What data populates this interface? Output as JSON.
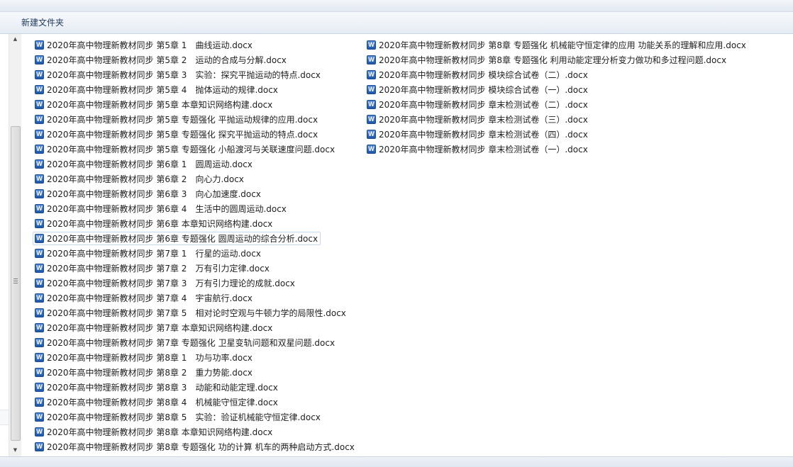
{
  "toolbar": {
    "new_folder_label": "新建文件夹"
  },
  "icons": {
    "file_icon": "word-document-icon",
    "file_icon_letter": "W",
    "file_icon_color": "#2a63b6"
  },
  "files_left": [
    "2020年高中物理新教材同步 第5章 1　曲线运动.docx",
    "2020年高中物理新教材同步 第5章 2　运动的合成与分解.docx",
    "2020年高中物理新教材同步 第5章 3　实验：探究平抛运动的特点.docx",
    "2020年高中物理新教材同步 第5章 4　抛体运动的规律.docx",
    "2020年高中物理新教材同步 第5章 本章知识网络构建.docx",
    "2020年高中物理新教材同步 第5章 专题强化 平抛运动规律的应用.docx",
    "2020年高中物理新教材同步 第5章 专题强化 探究平抛运动的特点.docx",
    "2020年高中物理新教材同步 第5章 专题强化 小船渡河与关联速度问题.docx",
    "2020年高中物理新教材同步 第6章 1　圆周运动.docx",
    "2020年高中物理新教材同步 第6章 2　向心力.docx",
    "2020年高中物理新教材同步 第6章 3　向心加速度.docx",
    "2020年高中物理新教材同步 第6章 4　生活中的圆周运动.docx",
    "2020年高中物理新教材同步 第6章 本章知识网络构建.docx",
    "2020年高中物理新教材同步 第6章 专题强化 圆周运动的综合分析.docx",
    "2020年高中物理新教材同步 第7章 1　行星的运动.docx",
    "2020年高中物理新教材同步 第7章 2　万有引力定律.docx",
    "2020年高中物理新教材同步 第7章 3　万有引力理论的成就.docx",
    "2020年高中物理新教材同步 第7章 4　宇宙航行.docx",
    "2020年高中物理新教材同步 第7章 5　相对论时空观与牛顿力学的局限性.docx",
    "2020年高中物理新教材同步 第7章 本章知识网络构建.docx",
    "2020年高中物理新教材同步 第7章 专题强化 卫星变轨问题和双星问题.docx",
    "2020年高中物理新教材同步 第8章 1　功与功率.docx",
    "2020年高中物理新教材同步 第8章 2　重力势能.docx",
    "2020年高中物理新教材同步 第8章 3　动能和动能定理.docx",
    "2020年高中物理新教材同步 第8章 4　机械能守恒定律.docx",
    "2020年高中物理新教材同步 第8章 5　实验：验证机械能守恒定律.docx",
    "2020年高中物理新教材同步 第8章 本章知识网络构建.docx",
    "2020年高中物理新教材同步 第8章 专题强化 功的计算 机车的两种启动方式.docx"
  ],
  "files_right": [
    "2020年高中物理新教材同步 第8章 专题强化 机械能守恒定律的应用 功能关系的理解和应用.docx",
    "2020年高中物理新教材同步 第8章 专题强化 利用动能定理分析变力做功和多过程问题.docx",
    "2020年高中物理新教材同步 模块综合试卷（二）.docx",
    "2020年高中物理新教材同步 模块综合试卷（一）.docx",
    "2020年高中物理新教材同步 章末检测试卷（二）.docx",
    "2020年高中物理新教材同步 章末检测试卷（三）.docx",
    "2020年高中物理新教材同步 章末检测试卷（四）.docx",
    "2020年高中物理新教材同步 章末检测试卷（一）.docx"
  ],
  "selected_file": "2020年高中物理新教材同步 第6章 专题强化 圆周运动的综合分析.docx"
}
